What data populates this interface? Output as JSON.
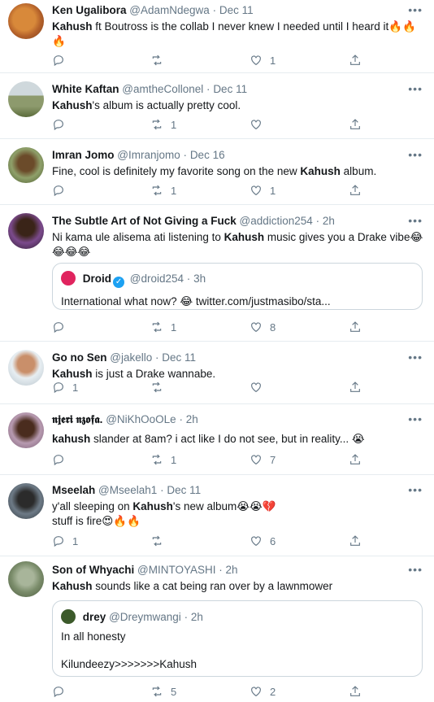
{
  "tweets": [
    {
      "name": "Ken Ugalibora",
      "handle": "@AdamNdegwa",
      "time": "Dec 11",
      "text_a": "",
      "bold": "Kahush",
      "text_b": " ft Boutross is the collab I never knew I needed until I heard it",
      "emoji": "🔥🔥🔥",
      "reply": "",
      "retweet": "",
      "like": "1"
    },
    {
      "name": "White Kaftan",
      "handle": "@amtheCollonel",
      "time": "Dec 11",
      "text_a": "",
      "bold": "Kahush",
      "text_b": "'s album is actually pretty cool.",
      "reply": "",
      "retweet": "1",
      "like": ""
    },
    {
      "name": "Imran Jomo",
      "handle": "@Imranjomo",
      "time": "Dec 16",
      "text_a": "Fine, cool is definitely my favorite song on the new ",
      "bold": "Kahush",
      "text_b": " album.",
      "reply": "",
      "retweet": "1",
      "like": "1"
    },
    {
      "name": "The Subtle Art of Not Giving a Fuck",
      "handle": "@addiction254",
      "time": "2h",
      "text_a": "Ni kama ule alisema ati listening to ",
      "bold": "Kahush",
      "text_b": " music gives you a Drake vibe",
      "emoji": "😂😂😂😂",
      "quote": {
        "name": "Droid",
        "handle": "@droid254",
        "time": "3h",
        "text": "International what now? 😂 twitter.com/justmasibo/sta..."
      },
      "reply": "",
      "retweet": "1",
      "like": "8"
    },
    {
      "name": "Go no Sen",
      "handle": "@jakello",
      "time": "Dec 11",
      "text_a": "",
      "bold": "Kahush",
      "text_b": " is just a Drake wannabe.",
      "reply": "1",
      "retweet": "",
      "like": ""
    },
    {
      "name": "𝖓𝖏𝖊𝖗𝖎 𝖓𝖟𝖔𝖋𝖆.",
      "handle": "@NiKhOoOLe",
      "time": "2h",
      "text_a": "",
      "bold": "kahush",
      "text_b": " slander at 8am? i act like I do not see, but in reality... 😭",
      "reply": "",
      "retweet": "1",
      "like": "7"
    },
    {
      "name": "Mseelah",
      "handle": "@Mseelah1",
      "time": "Dec 11",
      "text_a": "y'all sleeping on ",
      "bold": "Kahush",
      "text_b": "'s new album😭😭💔",
      "line2": "stuff is fire😍🔥🔥",
      "reply": "1",
      "retweet": "",
      "like": "6"
    },
    {
      "name": "Son of Whyachi",
      "handle": "@MINTOYASHI",
      "time": "2h",
      "text_a": "",
      "bold": "Kahush",
      "text_b": " sounds like a cat being ran over by a lawnmower",
      "quote": {
        "name": "drey",
        "handle": "@Dreymwangi",
        "time": "2h",
        "text": "In all honesty",
        "text2": "Kilundeezy>>>>>>>Kahush"
      },
      "reply": "",
      "retweet": "5",
      "like": "2"
    }
  ],
  "dot": "·",
  "more": "•••",
  "colors": {
    "text": "#14171a",
    "secondary": "#657786",
    "border": "#e6ecf0",
    "verified": "#1da1f2"
  },
  "icons": [
    "reply-icon",
    "retweet-icon",
    "like-icon",
    "share-icon",
    "more-icon",
    "verified-icon"
  ]
}
